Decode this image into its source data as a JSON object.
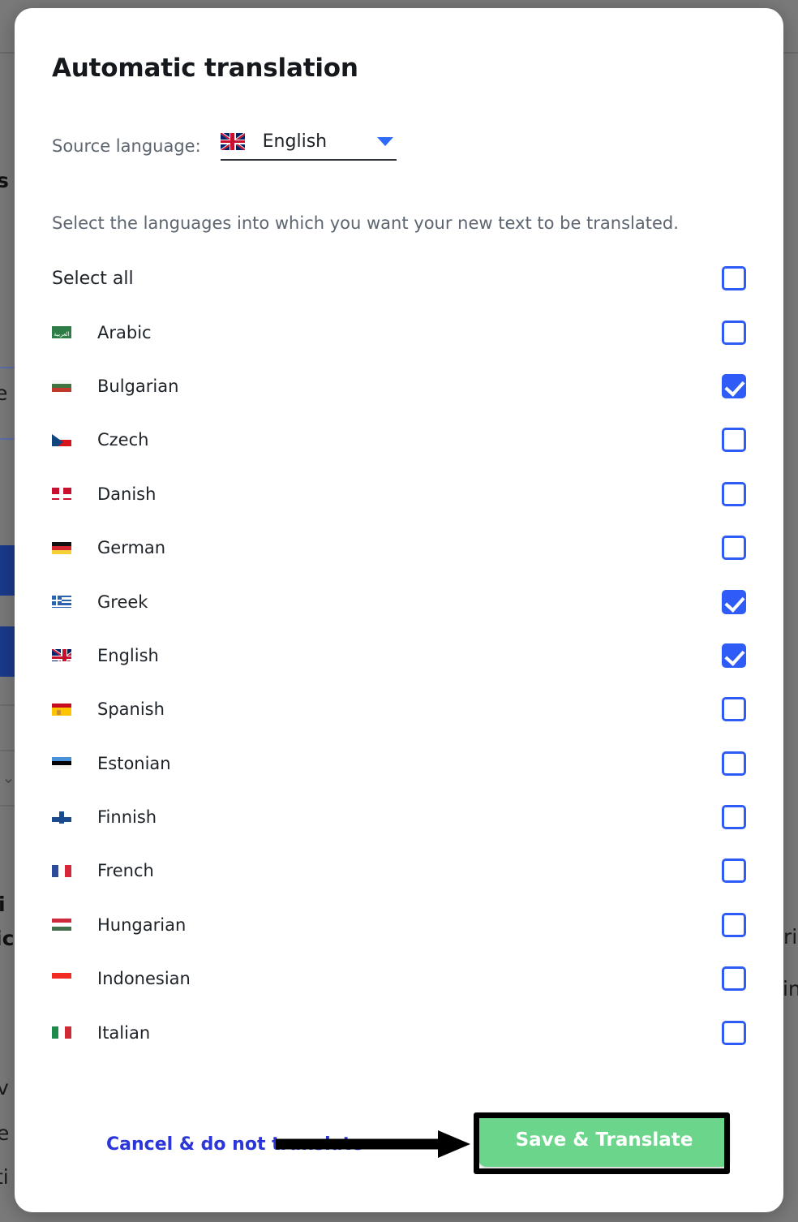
{
  "modal": {
    "title": "Automatic translation",
    "source_label": "Source language:",
    "source_value": "English",
    "source_flag": "flag-gb-icon",
    "hint": "Select the languages into which you want your new text to be translated.",
    "select_all_label": "Select all",
    "select_all_checked": false,
    "languages": [
      {
        "label": "Arabic",
        "flag": "flag-arabic-icon",
        "checked": false
      },
      {
        "label": "Bulgarian",
        "flag": "flag-bulgaria-icon",
        "checked": true
      },
      {
        "label": "Czech",
        "flag": "flag-czech-icon",
        "checked": false
      },
      {
        "label": "Danish",
        "flag": "flag-denmark-icon",
        "checked": false
      },
      {
        "label": "German",
        "flag": "flag-germany-icon",
        "checked": false
      },
      {
        "label": "Greek",
        "flag": "flag-greece-icon",
        "checked": true
      },
      {
        "label": "English",
        "flag": "flag-gb-icon",
        "checked": true
      },
      {
        "label": "Spanish",
        "flag": "flag-spain-icon",
        "checked": false
      },
      {
        "label": "Estonian",
        "flag": "flag-estonia-icon",
        "checked": false
      },
      {
        "label": "Finnish",
        "flag": "flag-finland-icon",
        "checked": false
      },
      {
        "label": "French",
        "flag": "flag-france-icon",
        "checked": false
      },
      {
        "label": "Hungarian",
        "flag": "flag-hungary-icon",
        "checked": false
      },
      {
        "label": "Indonesian",
        "flag": "flag-indonesia-icon",
        "checked": false
      },
      {
        "label": "Italian",
        "flag": "flag-italy-icon",
        "checked": false
      }
    ],
    "cancel_label": "Cancel & do not translate",
    "save_label": "Save & Translate"
  },
  "background": {
    "fragments": [
      "s",
      "e",
      "i",
      "ic",
      "v",
      "e",
      "ti",
      "ri",
      "lin"
    ]
  },
  "colors": {
    "checkbox_blue": "#2f5cf6",
    "save_green": "#6BD58B",
    "cancel_blue": "#2b35d8",
    "caret_blue": "#2f6bf6",
    "overlay_gray": "#7a7a7a",
    "bg_bar_navy": "#1b3a8c",
    "annotation_black": "#000000"
  }
}
